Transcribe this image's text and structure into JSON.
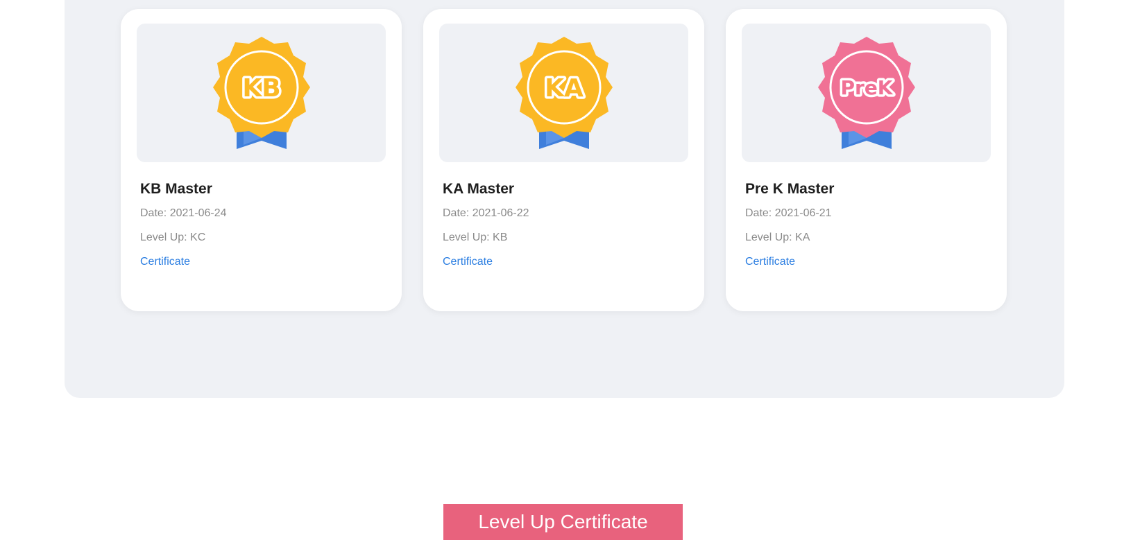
{
  "badges": [
    {
      "badge_text": "KB",
      "badge_color": "#fbb824",
      "ribbon_color": "#3f7fdb",
      "title": "KB Master",
      "date": "Date: 2021-06-24",
      "level_up": "Level Up: KC",
      "link_label": "Certificate"
    },
    {
      "badge_text": "KA",
      "badge_color": "#fbb824",
      "ribbon_color": "#3f7fdb",
      "title": "KA Master",
      "date": "Date: 2021-06-22",
      "level_up": "Level Up: KB",
      "link_label": "Certificate"
    },
    {
      "badge_text": "PreK",
      "badge_color": "#f07195",
      "ribbon_color": "#3f7fdb",
      "title": "Pre K Master",
      "date": "Date: 2021-06-21",
      "level_up": "Level Up: KA",
      "link_label": "Certificate"
    }
  ],
  "cta": {
    "label": "Level Up Certificate",
    "color": "#e8627d"
  }
}
